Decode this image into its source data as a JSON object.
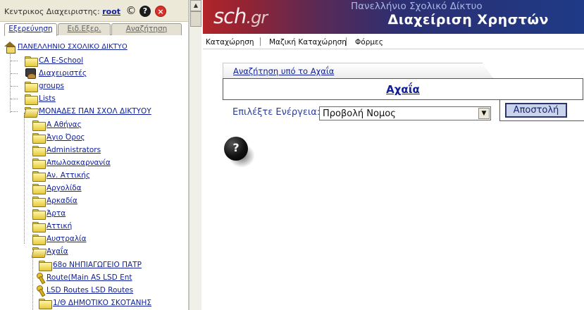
{
  "admin_bar": {
    "label": "Κεντρικος Διαχειριστης:",
    "user": "root",
    "icons": [
      "copyright-icon",
      "help-icon",
      "close-icon"
    ],
    "copyright_glyph": "©",
    "help_glyph": "?",
    "close_glyph": "×"
  },
  "tabs": [
    {
      "label": "Εξερεύνηση",
      "active": true
    },
    {
      "label": "Ειδ.Εξερ.",
      "active": false
    },
    {
      "label": "Αναζήτηση",
      "active": false
    }
  ],
  "tree": {
    "root": "ΠΑΝΕΛΛΗΝΙΟ ΣΧΟΛΙΚΟ ΔΙΚΤΥΟ",
    "level1": [
      "CA E-School",
      "Διαχειριστές",
      "groups",
      "Lists",
      "ΜΟΝΑΔΕΣ ΠΑΝ ΣΧΟΛ ΔΙΚΤΥΟΥ"
    ],
    "level2": [
      "Α Αθήνας",
      "Άγιο Όρος",
      "Administrators",
      "Απωλοακαρνανία",
      "Αν. Αττικής",
      "Αργολίδα",
      "Αρκαδία",
      "Άρτα",
      "Αττική",
      "Αυστραλία",
      "Αχαΐα"
    ],
    "level3": [
      "68ο ΝΗΠΙΑΓΩΓΕΙΟ ΠΑΤΡ",
      "Route(Main AS LSD Ent",
      "LSD Routes LSD Routes",
      "1/Θ ΔΗΜΟΤΙΚΟ ΣΚΟΤΑΝΗΣ"
    ]
  },
  "scrollbar": {
    "up_glyph": "▲"
  },
  "banner": {
    "logo": "sch",
    "logo_domain": ".gr",
    "subtitle": "Πανελλήνιο Σχολικό Δίκτυο",
    "title": "Διαχείριση Χρηστών"
  },
  "menu": [
    "Καταχώρηση",
    "Μαζική Καταχώρηση",
    "Φόρμες"
  ],
  "main": {
    "crumb": "Αναζήτηση υπό το Αχαΐα",
    "heading": "Αχαΐα",
    "action_label": "Επιλέξτε Ενέργεια:",
    "action_value": "Προβολή Νομος",
    "select_arrow_glyph": "▼",
    "submit": "Αποστολή",
    "help_glyph": "?"
  }
}
